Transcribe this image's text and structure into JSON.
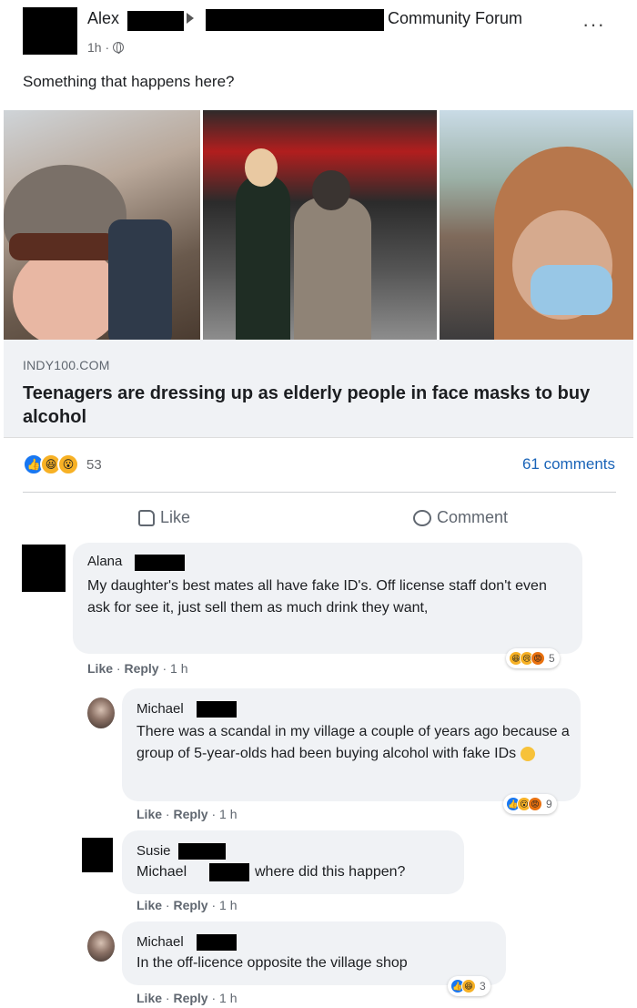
{
  "post": {
    "author": "Alex",
    "group": "Community Forum",
    "time": "1h ·",
    "text": "Something that happens here?",
    "more_label": "···"
  },
  "link": {
    "domain": "INDY100.COM",
    "headline": "Teenagers are dressing up as elderly people in face masks to buy alcohol"
  },
  "stats": {
    "reaction_count": "53",
    "comments": "61 comments",
    "reaction_icons": [
      "like-icon",
      "haha-icon",
      "wow-icon"
    ]
  },
  "actions": {
    "like": "Like",
    "comment": "Comment"
  },
  "comments": [
    {
      "name": "Alana",
      "text": "My daughter's best mates all have fake ID's. Off license staff don't even ask for see it, just sell them as much drink they want,",
      "like": "Like",
      "reply": "Reply",
      "time": "· 1 h",
      "reactions": "5"
    },
    {
      "name": "Michael",
      "text": "There was a scandal in my village a couple of years ago because a group of 5-year-olds had been buying alcohol with fake IDs",
      "like": "Like",
      "reply": "Reply",
      "time": "· 1 h",
      "reactions": "9"
    },
    {
      "name": "Susie",
      "mention": "Michael",
      "text": "where did this happen?",
      "like": "Like",
      "reply": "Reply",
      "time": "· 1 h"
    },
    {
      "name": "Michael",
      "text": "In the off-licence opposite the village shop",
      "like": "Like",
      "reply": "Reply",
      "time": "· 1 h",
      "reactions": "3"
    }
  ],
  "colors": {
    "link_blue": "#1a64b8",
    "like_blue": "#1877f2",
    "bubble_grey": "#f0f2f5",
    "haha_yellow": "#f7b125"
  }
}
